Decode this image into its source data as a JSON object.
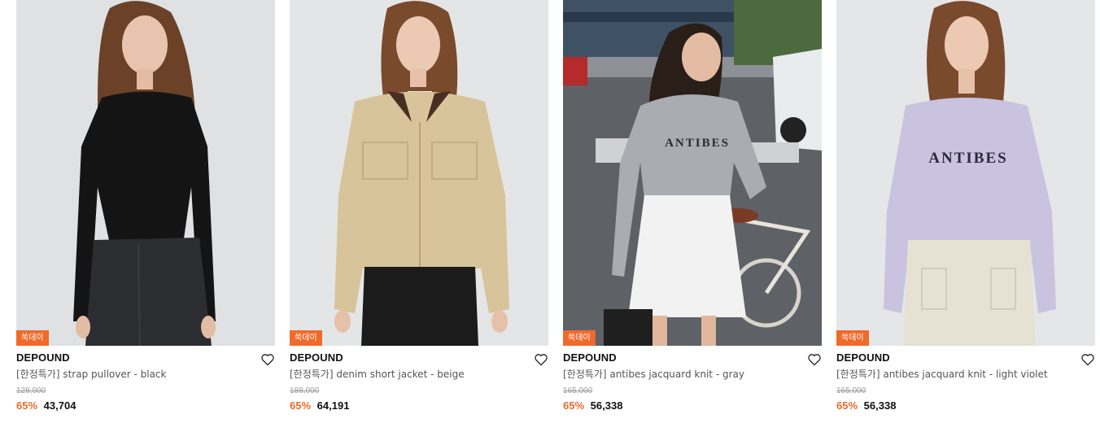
{
  "colors": {
    "accent": "#f06a2b",
    "strike": "#9a9a9a"
  },
  "products": [
    {
      "badge": "쑥데이",
      "brand": "DEPOUND",
      "title": "[한정특가] strap pullover - black",
      "original_price": "128,000",
      "discount": "65%",
      "price": "43,704",
      "image": "model-black-pullover",
      "wishlist_icon": "heart-outline-icon"
    },
    {
      "badge": "쑥데이",
      "brand": "DEPOUND",
      "title": "[한정특가] denim short jacket - beige",
      "original_price": "188,000",
      "discount": "65%",
      "price": "64,191",
      "image": "model-beige-jacket",
      "wishlist_icon": "heart-outline-icon"
    },
    {
      "badge": "쑥데이",
      "brand": "DEPOUND",
      "title": "[한정특가] antibes jacquard knit - gray",
      "original_price": "165,000",
      "discount": "65%",
      "price": "56,338",
      "image": "model-gray-knit-street",
      "sweater_text": "ANTIBES",
      "wishlist_icon": "heart-outline-icon"
    },
    {
      "badge": "쑥데이",
      "brand": "DEPOUND",
      "title": "[한정특가] antibes jacquard knit - light violet",
      "original_price": "165,000",
      "discount": "65%",
      "price": "56,338",
      "image": "model-violet-knit",
      "sweater_text": "ANTIBES",
      "wishlist_icon": "heart-outline-icon"
    }
  ]
}
